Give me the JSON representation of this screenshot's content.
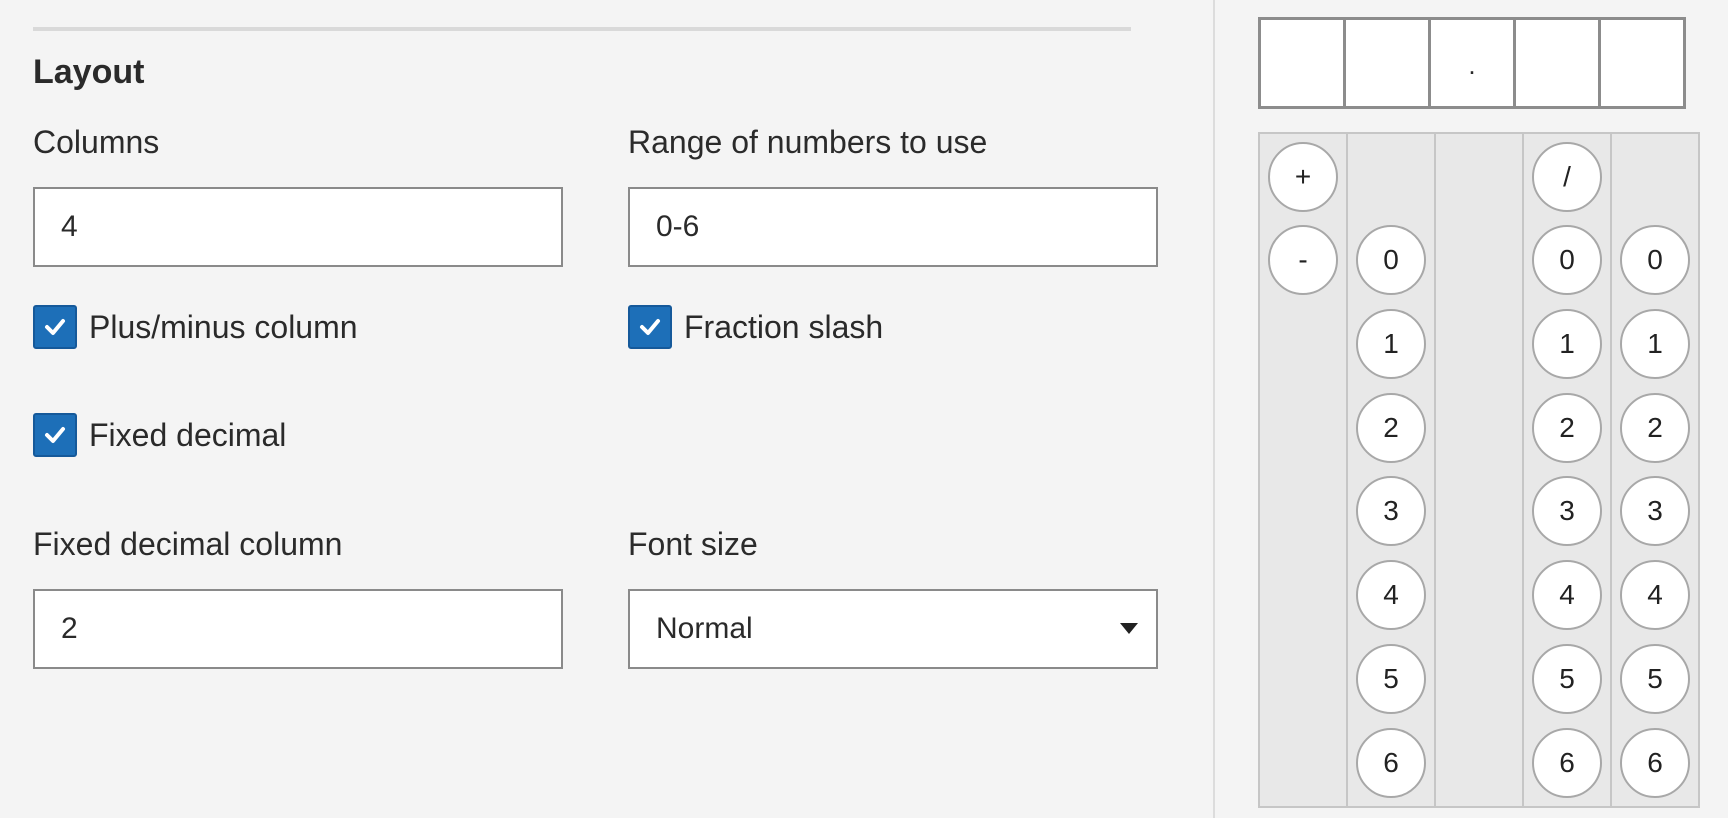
{
  "layout": {
    "title": "Layout",
    "columns_label": "Columns",
    "columns_value": "4",
    "range_label": "Range of numbers to use",
    "range_value": "0-6",
    "plus_minus_label": "Plus/minus column",
    "plus_minus_checked": true,
    "fraction_label": "Fraction slash",
    "fraction_checked": true,
    "fixed_decimal_label": "Fixed decimal",
    "fixed_decimal_checked": true,
    "fixed_decimal_column_label": "Fixed decimal column",
    "fixed_decimal_column_value": "2",
    "font_size_label": "Font size",
    "font_size_value": "Normal"
  },
  "preview": {
    "answer_cells": [
      "",
      "",
      ".",
      "",
      ""
    ],
    "signs": [
      "+",
      "-"
    ],
    "fraction_slash": "/",
    "digits": [
      "0",
      "1",
      "2",
      "3",
      "4",
      "5",
      "6"
    ]
  },
  "colors": {
    "accent": "#1d6fb8",
    "background": "#f4f4f4"
  },
  "icons": {
    "checkbox": "checkmark-icon",
    "dropdown": "chevron-down-icon"
  }
}
